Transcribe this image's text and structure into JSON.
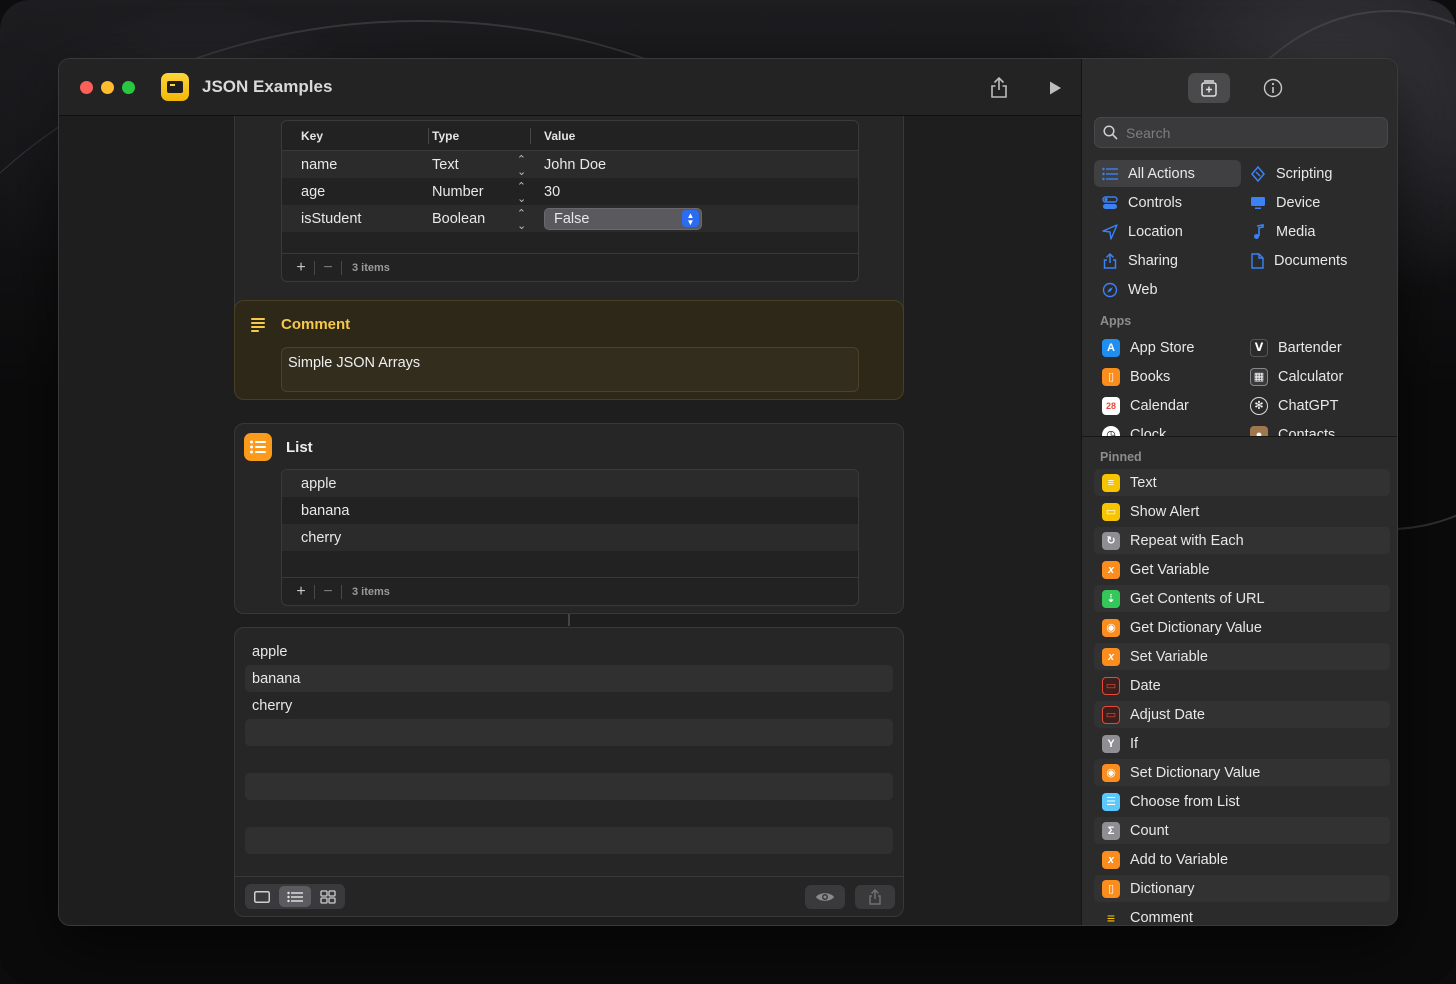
{
  "window": {
    "title": "JSON Examples"
  },
  "dictionary": {
    "columns": [
      "Key",
      "Type",
      "Value"
    ],
    "rows": [
      {
        "key": "name",
        "type": "Text",
        "value": "John Doe"
      },
      {
        "key": "age",
        "type": "Number",
        "value": "30"
      },
      {
        "key": "isStudent",
        "type": "Boolean",
        "value": "False"
      }
    ],
    "count_label": "3 items"
  },
  "comment": {
    "title": "Comment",
    "text": "Simple JSON Arrays"
  },
  "list": {
    "title": "List",
    "items": [
      "apple",
      "banana",
      "cherry"
    ],
    "count_label": "3 items"
  },
  "output": {
    "items": [
      "apple",
      "banana",
      "cherry"
    ]
  },
  "sidebar": {
    "search_placeholder": "Search",
    "categories": [
      {
        "label": "All Actions",
        "icon": "list-icon",
        "color": "#3b82f6"
      },
      {
        "label": "Scripting",
        "icon": "scripting-icon",
        "color": "#3b82f6"
      },
      {
        "label": "Controls",
        "icon": "toggle-icon",
        "color": "#3b82f6"
      },
      {
        "label": "Device",
        "icon": "monitor-icon",
        "color": "#3b82f6"
      },
      {
        "label": "Location",
        "icon": "location-arrow-icon",
        "color": "#3b82f6"
      },
      {
        "label": "Media",
        "icon": "music-note-icon",
        "color": "#3b82f6"
      },
      {
        "label": "Sharing",
        "icon": "share-icon",
        "color": "#3b82f6"
      },
      {
        "label": "Documents",
        "icon": "document-icon",
        "color": "#3b82f6"
      },
      {
        "label": "Web",
        "icon": "compass-icon",
        "color": "#3b82f6"
      }
    ],
    "apps_label": "Apps",
    "apps": [
      {
        "label": "App Store",
        "icon": "app-store-icon",
        "color": "#1f8ef1"
      },
      {
        "label": "Bartender",
        "icon": "bartender-icon",
        "color": "#3a3a3c"
      },
      {
        "label": "Books",
        "icon": "books-icon",
        "color": "#fb8c1e"
      },
      {
        "label": "Calculator",
        "icon": "calculator-icon",
        "color": "#3a3a3c"
      },
      {
        "label": "Calendar",
        "icon": "calendar-icon",
        "color": "#ffffff"
      },
      {
        "label": "ChatGPT",
        "icon": "chatgpt-icon",
        "color": "#3a3a3c"
      },
      {
        "label": "Clock",
        "icon": "clock-icon",
        "color": "#ffffff"
      },
      {
        "label": "Contacts",
        "icon": "contacts-icon",
        "color": "#a0774c"
      }
    ],
    "pinned_label": "Pinned",
    "pinned": [
      {
        "label": "Text",
        "icon": "text-icon",
        "color": "#f6c400"
      },
      {
        "label": "Show Alert",
        "icon": "alert-icon",
        "color": "#f6c400"
      },
      {
        "label": "Repeat with Each",
        "icon": "repeat-icon",
        "color": "#8e8e93"
      },
      {
        "label": "Get Variable",
        "icon": "variable-icon",
        "color": "#fb8c1e"
      },
      {
        "label": "Get Contents of URL",
        "icon": "url-icon",
        "color": "#34c759"
      },
      {
        "label": "Get Dictionary Value",
        "icon": "dictionary-icon",
        "color": "#fb8c1e"
      },
      {
        "label": "Set Variable",
        "icon": "variable-icon",
        "color": "#fb8c1e"
      },
      {
        "label": "Date",
        "icon": "date-icon",
        "color": "#e5493a"
      },
      {
        "label": "Adjust Date",
        "icon": "adjust-date-icon",
        "color": "#e5493a"
      },
      {
        "label": "If",
        "icon": "if-icon",
        "color": "#8e8e93"
      },
      {
        "label": "Set Dictionary Value",
        "icon": "dictionary-icon",
        "color": "#fb8c1e"
      },
      {
        "label": "Choose from List",
        "icon": "choose-list-icon",
        "color": "#5ac8fa"
      },
      {
        "label": "Count",
        "icon": "sigma-icon",
        "color": "#8e8e93"
      },
      {
        "label": "Add to Variable",
        "icon": "variable-icon",
        "color": "#fb8c1e"
      },
      {
        "label": "Dictionary",
        "icon": "dictionary-icon",
        "color": "#fb8c1e"
      },
      {
        "label": "Comment",
        "icon": "comment-icon",
        "color": "#f6c400"
      }
    ]
  }
}
